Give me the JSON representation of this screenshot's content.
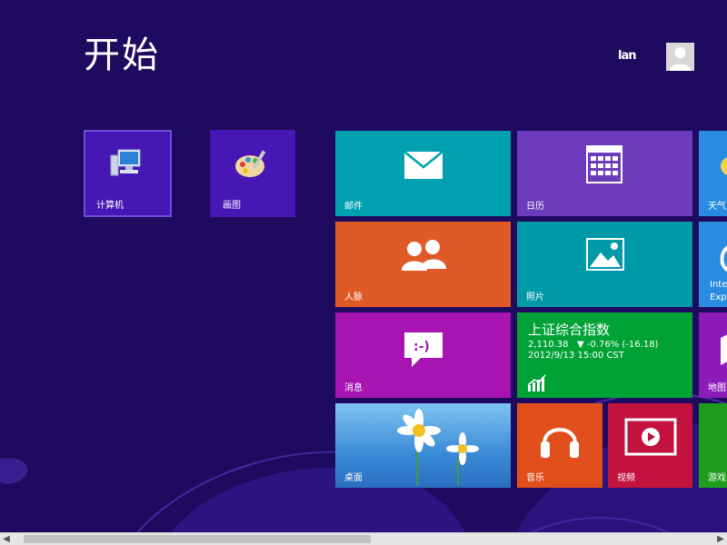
{
  "header": {
    "title": "开始",
    "user_name": "lan"
  },
  "tiles": {
    "computer": "计算机",
    "paint": "画图",
    "mail": "邮件",
    "calendar": "日历",
    "weather": "天气",
    "people": "人脉",
    "photos": "照片",
    "ie_line1": "Inter",
    "ie_line2": "Expl",
    "messaging": "消息",
    "finance": {
      "title": "上证综合指数",
      "value": "2,110.38",
      "change": "▼ -0.76% (-16.18)",
      "timestamp": "2012/9/13 15:00 CST"
    },
    "maps": "地图",
    "desktop": "桌面",
    "music": "音乐",
    "video": "视频",
    "games": "游戏"
  },
  "colors": {
    "background": "#1e0a5e",
    "small_tile": "#4617b4",
    "mail": "#00a0b0",
    "calendar": "#6b3bbb",
    "weather": "#2a8ce0",
    "people": "#e05a28",
    "photos": "#009aa6",
    "ie": "#2a8ce0",
    "messaging": "#a714b2",
    "finance": "#00a236",
    "maps": "#8c1bb8",
    "desktop": "#4a9ee0",
    "music": "#e1501c",
    "video": "#c2123e",
    "games": "#1e9c1e"
  },
  "icons": {
    "computer": "computer-monitor-icon",
    "paint": "paint-palette-icon",
    "mail": "envelope-icon",
    "calendar": "calendar-grid-icon",
    "weather": "sun-icon",
    "people": "people-icon",
    "photos": "picture-icon",
    "ie": "internet-explorer-icon",
    "messaging": "speech-bubble-icon",
    "finance": "bar-chart-icon",
    "maps": "map-icon",
    "music": "headphones-icon",
    "video": "play-button-icon"
  },
  "scrollbar": {
    "position": 0.0,
    "visible_fraction": 0.48
  }
}
